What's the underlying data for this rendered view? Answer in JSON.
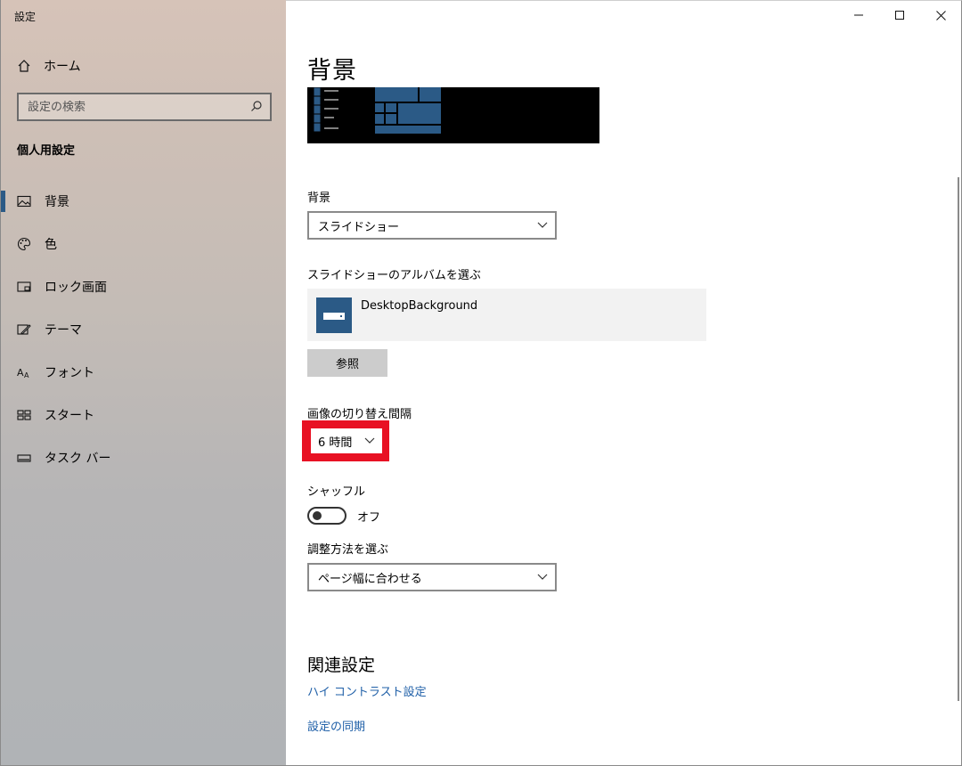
{
  "window": {
    "title": "設定"
  },
  "sidebar": {
    "home_label": "ホーム",
    "search_placeholder": "設定の検索",
    "section_title": "個人用設定",
    "items": [
      {
        "label": "背景",
        "icon": "picture-icon",
        "active": true
      },
      {
        "label": "色",
        "icon": "palette-icon",
        "active": false
      },
      {
        "label": "ロック画面",
        "icon": "lock-screen-icon",
        "active": false
      },
      {
        "label": "テーマ",
        "icon": "theme-icon",
        "active": false
      },
      {
        "label": "フォント",
        "icon": "font-icon",
        "active": false
      },
      {
        "label": "スタート",
        "icon": "start-icon",
        "active": false
      },
      {
        "label": "タスク バー",
        "icon": "taskbar-icon",
        "active": false
      }
    ]
  },
  "main": {
    "title": "背景",
    "background": {
      "label": "背景",
      "value": "スライドショー"
    },
    "album": {
      "label": "スライドショーのアルバムを選ぶ",
      "name": "DesktopBackground",
      "browse_label": "参照"
    },
    "interval": {
      "label": "画像の切り替え間隔",
      "value": "6 時間"
    },
    "shuffle": {
      "label": "シャッフル",
      "state_label": "オフ",
      "on": false
    },
    "fit": {
      "label": "調整方法を選ぶ",
      "value": "ページ幅に合わせる"
    },
    "related": {
      "title": "関連設定",
      "links": [
        "ハイ コントラスト設定",
        "設定の同期"
      ]
    }
  },
  "colors": {
    "accent": "#2b5a86",
    "link": "#2060a8",
    "highlight": "#e81123"
  }
}
